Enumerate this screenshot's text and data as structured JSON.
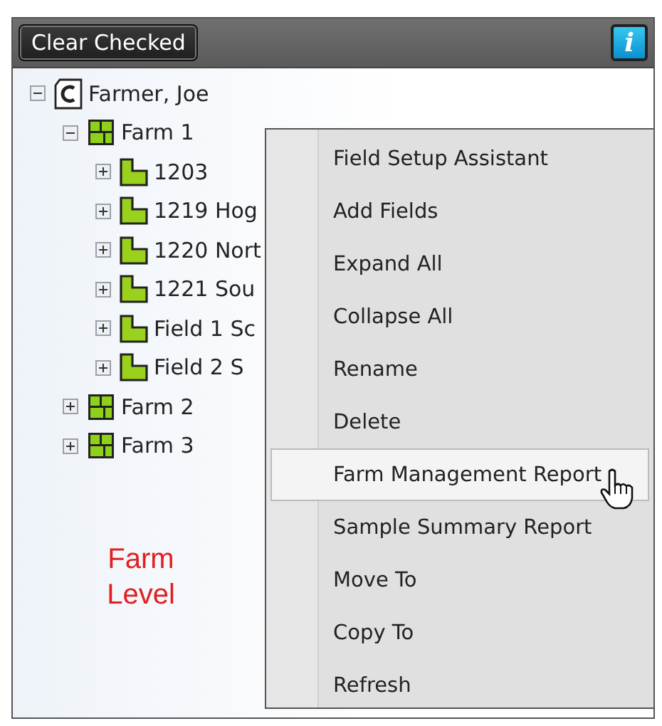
{
  "toolbar": {
    "clear_button": "Clear Checked",
    "info_button": "i"
  },
  "tree": [
    {
      "label": "Farmer, Joe",
      "kind": "client",
      "expanded": true,
      "children": [
        {
          "label": "Farm 1",
          "kind": "farm",
          "expanded": true,
          "children": [
            {
              "label": "1203",
              "kind": "field",
              "expanded": false
            },
            {
              "label": "1219 Hog",
              "kind": "field",
              "expanded": false
            },
            {
              "label": "1220 Nort",
              "kind": "field",
              "expanded": false
            },
            {
              "label": "1221 Sou",
              "kind": "field",
              "expanded": false
            },
            {
              "label": "Field 1 Sc",
              "kind": "field",
              "expanded": false
            },
            {
              "label": "Field 2 S",
              "kind": "field",
              "expanded": false
            }
          ]
        },
        {
          "label": "Farm 2",
          "kind": "farm",
          "expanded": false
        },
        {
          "label": "Farm 3",
          "kind": "farm",
          "expanded": false
        }
      ]
    }
  ],
  "annotation": "Farm Level",
  "context_menu": [
    {
      "label": "Field Setup Assistant",
      "highlighted": false
    },
    {
      "label": "Add Fields",
      "highlighted": false
    },
    {
      "label": "Expand All",
      "highlighted": false
    },
    {
      "label": "Collapse All",
      "highlighted": false
    },
    {
      "label": "Rename",
      "highlighted": false
    },
    {
      "label": "Delete",
      "highlighted": false
    },
    {
      "label": "Farm Management Report",
      "highlighted": true
    },
    {
      "label": "Sample Summary Report",
      "highlighted": false
    },
    {
      "label": "Move To",
      "highlighted": false
    },
    {
      "label": "Copy To",
      "highlighted": false
    },
    {
      "label": "Refresh",
      "highlighted": false
    }
  ]
}
